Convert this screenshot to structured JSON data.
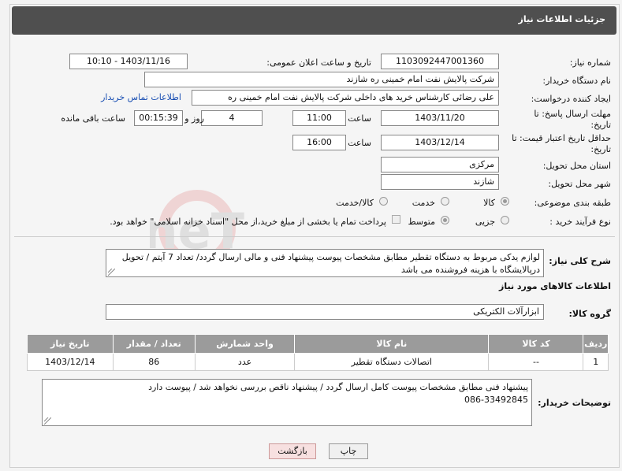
{
  "header": {
    "title": "جزئیات اطلاعات نیاز"
  },
  "form": {
    "need_number": {
      "label": "شماره نیاز:",
      "value": "1103092447001360"
    },
    "announce_datetime": {
      "label": "تاریخ و ساعت اعلان عمومی:",
      "value": "1403/11/16 - 10:10"
    },
    "buyer_org": {
      "label": "نام دستگاه خریدار:",
      "value": "شرکت پالایش نفت امام خمینی  ره  شازند"
    },
    "requester": {
      "label": "ایجاد کننده درخواست:",
      "value": "علی  رضائی کارشناس خرید های داخلی  شرکت پالایش نفت امام خمینی  ره",
      "contact_link": "اطلاعات تماس خریدار"
    },
    "reply_deadline": {
      "label_line1": "مهلت ارسال پاسخ: تا",
      "label_line2": "تاریخ:",
      "date": "1403/11/20",
      "time_label": "ساعت",
      "time": "11:00",
      "days": "4",
      "days_label": "روز و",
      "remaining": "00:15:39",
      "remaining_label": "ساعت باقی مانده"
    },
    "price_validity": {
      "label_line1": "حداقل تاریخ اعتبار قیمت: تا",
      "label_line2": "تاریخ:",
      "date": "1403/12/14",
      "time_label": "ساعت",
      "time": "16:00"
    },
    "province": {
      "label": "استان محل تحویل:",
      "value": "مرکزی"
    },
    "city": {
      "label": "شهر محل تحویل:",
      "value": "شازند"
    },
    "category": {
      "label": "طبقه بندی موضوعی:",
      "options": [
        "کالا",
        "خدمت",
        "کالا/خدمت"
      ],
      "selected": "کالا"
    },
    "process_type": {
      "label": "نوع فرآیند خرید :",
      "options": [
        "جزیی",
        "متوسط"
      ],
      "selected": "متوسط",
      "payment_note": "پرداخت تمام یا بخشی از مبلغ خرید،از محل \"اسناد خزانه اسلامی\" خواهد بود."
    }
  },
  "description": {
    "label": "شرح کلی نیاز:",
    "text": "لوازم یدکی مربوط به دستگاه تقطیر مطابق مشخصات پیوست پیشنهاد فنی و مالی ارسال گردد/ تعداد 7 آیتم / تحویل درپالایشگاه با هزینه فروشنده می  باشد"
  },
  "goods_info": {
    "section_title": "اطلاعات کالاهای مورد نیاز",
    "group_label": "گروه کالا:",
    "group_value": "ابزارآلات الکتریکی"
  },
  "table": {
    "columns": [
      "ردیف",
      "کد کالا",
      "نام کالا",
      "واحد شمارش",
      "تعداد / مقدار",
      "تاریخ نیاز"
    ],
    "rows": [
      {
        "row": "1",
        "code": "--",
        "name": "اتصالات دستگاه تقطیر",
        "unit": "عدد",
        "qty": "86",
        "date": "1403/12/14"
      }
    ]
  },
  "buyer_notes": {
    "label": "توضیحات خریدار:",
    "line1": "پیشنهاد فنی مطابق مشخصات پیوست کامل ارسال گردد / پیشنهاد ناقص بررسی نخواهد شد / پیوست دارد",
    "line2": "086-33492845"
  },
  "buttons": {
    "print": "چاپ",
    "back": "بازگشت"
  },
  "watermark": {
    "text": "AriaTender.neT"
  },
  "colors": {
    "header_bg": "#4f4f4f",
    "table_header_bg": "#9b9b9b",
    "link": "#1a4fb3",
    "back_button_bg": "#f7e0e0"
  }
}
